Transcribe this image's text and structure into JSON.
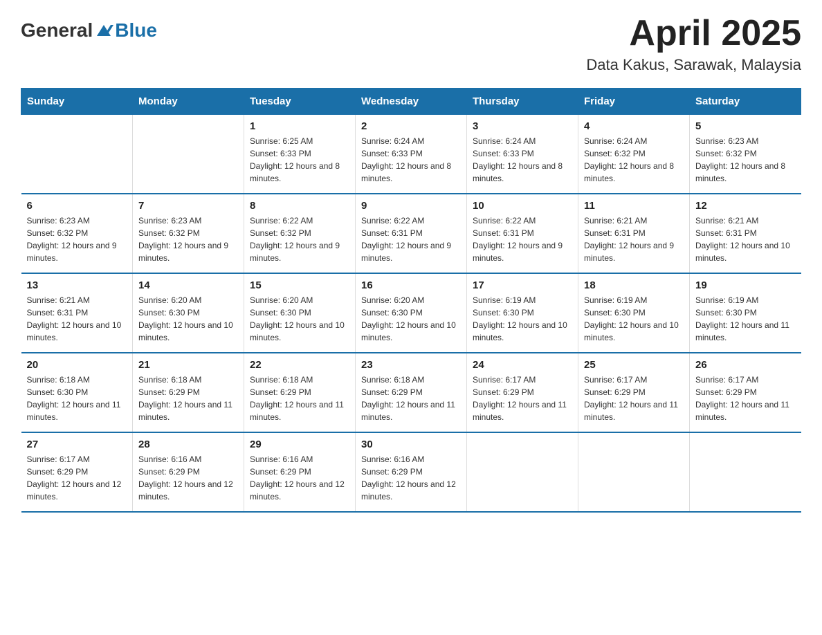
{
  "header": {
    "logo_general": "General",
    "logo_blue": "Blue",
    "month_title": "April 2025",
    "location": "Data Kakus, Sarawak, Malaysia"
  },
  "days_of_week": [
    "Sunday",
    "Monday",
    "Tuesday",
    "Wednesday",
    "Thursday",
    "Friday",
    "Saturday"
  ],
  "weeks": [
    [
      {
        "day": "",
        "sunrise": "",
        "sunset": "",
        "daylight": ""
      },
      {
        "day": "",
        "sunrise": "",
        "sunset": "",
        "daylight": ""
      },
      {
        "day": "1",
        "sunrise": "Sunrise: 6:25 AM",
        "sunset": "Sunset: 6:33 PM",
        "daylight": "Daylight: 12 hours and 8 minutes."
      },
      {
        "day": "2",
        "sunrise": "Sunrise: 6:24 AM",
        "sunset": "Sunset: 6:33 PM",
        "daylight": "Daylight: 12 hours and 8 minutes."
      },
      {
        "day": "3",
        "sunrise": "Sunrise: 6:24 AM",
        "sunset": "Sunset: 6:33 PM",
        "daylight": "Daylight: 12 hours and 8 minutes."
      },
      {
        "day": "4",
        "sunrise": "Sunrise: 6:24 AM",
        "sunset": "Sunset: 6:32 PM",
        "daylight": "Daylight: 12 hours and 8 minutes."
      },
      {
        "day": "5",
        "sunrise": "Sunrise: 6:23 AM",
        "sunset": "Sunset: 6:32 PM",
        "daylight": "Daylight: 12 hours and 8 minutes."
      }
    ],
    [
      {
        "day": "6",
        "sunrise": "Sunrise: 6:23 AM",
        "sunset": "Sunset: 6:32 PM",
        "daylight": "Daylight: 12 hours and 9 minutes."
      },
      {
        "day": "7",
        "sunrise": "Sunrise: 6:23 AM",
        "sunset": "Sunset: 6:32 PM",
        "daylight": "Daylight: 12 hours and 9 minutes."
      },
      {
        "day": "8",
        "sunrise": "Sunrise: 6:22 AM",
        "sunset": "Sunset: 6:32 PM",
        "daylight": "Daylight: 12 hours and 9 minutes."
      },
      {
        "day": "9",
        "sunrise": "Sunrise: 6:22 AM",
        "sunset": "Sunset: 6:31 PM",
        "daylight": "Daylight: 12 hours and 9 minutes."
      },
      {
        "day": "10",
        "sunrise": "Sunrise: 6:22 AM",
        "sunset": "Sunset: 6:31 PM",
        "daylight": "Daylight: 12 hours and 9 minutes."
      },
      {
        "day": "11",
        "sunrise": "Sunrise: 6:21 AM",
        "sunset": "Sunset: 6:31 PM",
        "daylight": "Daylight: 12 hours and 9 minutes."
      },
      {
        "day": "12",
        "sunrise": "Sunrise: 6:21 AM",
        "sunset": "Sunset: 6:31 PM",
        "daylight": "Daylight: 12 hours and 10 minutes."
      }
    ],
    [
      {
        "day": "13",
        "sunrise": "Sunrise: 6:21 AM",
        "sunset": "Sunset: 6:31 PM",
        "daylight": "Daylight: 12 hours and 10 minutes."
      },
      {
        "day": "14",
        "sunrise": "Sunrise: 6:20 AM",
        "sunset": "Sunset: 6:30 PM",
        "daylight": "Daylight: 12 hours and 10 minutes."
      },
      {
        "day": "15",
        "sunrise": "Sunrise: 6:20 AM",
        "sunset": "Sunset: 6:30 PM",
        "daylight": "Daylight: 12 hours and 10 minutes."
      },
      {
        "day": "16",
        "sunrise": "Sunrise: 6:20 AM",
        "sunset": "Sunset: 6:30 PM",
        "daylight": "Daylight: 12 hours and 10 minutes."
      },
      {
        "day": "17",
        "sunrise": "Sunrise: 6:19 AM",
        "sunset": "Sunset: 6:30 PM",
        "daylight": "Daylight: 12 hours and 10 minutes."
      },
      {
        "day": "18",
        "sunrise": "Sunrise: 6:19 AM",
        "sunset": "Sunset: 6:30 PM",
        "daylight": "Daylight: 12 hours and 10 minutes."
      },
      {
        "day": "19",
        "sunrise": "Sunrise: 6:19 AM",
        "sunset": "Sunset: 6:30 PM",
        "daylight": "Daylight: 12 hours and 11 minutes."
      }
    ],
    [
      {
        "day": "20",
        "sunrise": "Sunrise: 6:18 AM",
        "sunset": "Sunset: 6:30 PM",
        "daylight": "Daylight: 12 hours and 11 minutes."
      },
      {
        "day": "21",
        "sunrise": "Sunrise: 6:18 AM",
        "sunset": "Sunset: 6:29 PM",
        "daylight": "Daylight: 12 hours and 11 minutes."
      },
      {
        "day": "22",
        "sunrise": "Sunrise: 6:18 AM",
        "sunset": "Sunset: 6:29 PM",
        "daylight": "Daylight: 12 hours and 11 minutes."
      },
      {
        "day": "23",
        "sunrise": "Sunrise: 6:18 AM",
        "sunset": "Sunset: 6:29 PM",
        "daylight": "Daylight: 12 hours and 11 minutes."
      },
      {
        "day": "24",
        "sunrise": "Sunrise: 6:17 AM",
        "sunset": "Sunset: 6:29 PM",
        "daylight": "Daylight: 12 hours and 11 minutes."
      },
      {
        "day": "25",
        "sunrise": "Sunrise: 6:17 AM",
        "sunset": "Sunset: 6:29 PM",
        "daylight": "Daylight: 12 hours and 11 minutes."
      },
      {
        "day": "26",
        "sunrise": "Sunrise: 6:17 AM",
        "sunset": "Sunset: 6:29 PM",
        "daylight": "Daylight: 12 hours and 11 minutes."
      }
    ],
    [
      {
        "day": "27",
        "sunrise": "Sunrise: 6:17 AM",
        "sunset": "Sunset: 6:29 PM",
        "daylight": "Daylight: 12 hours and 12 minutes."
      },
      {
        "day": "28",
        "sunrise": "Sunrise: 6:16 AM",
        "sunset": "Sunset: 6:29 PM",
        "daylight": "Daylight: 12 hours and 12 minutes."
      },
      {
        "day": "29",
        "sunrise": "Sunrise: 6:16 AM",
        "sunset": "Sunset: 6:29 PM",
        "daylight": "Daylight: 12 hours and 12 minutes."
      },
      {
        "day": "30",
        "sunrise": "Sunrise: 6:16 AM",
        "sunset": "Sunset: 6:29 PM",
        "daylight": "Daylight: 12 hours and 12 minutes."
      },
      {
        "day": "",
        "sunrise": "",
        "sunset": "",
        "daylight": ""
      },
      {
        "day": "",
        "sunrise": "",
        "sunset": "",
        "daylight": ""
      },
      {
        "day": "",
        "sunrise": "",
        "sunset": "",
        "daylight": ""
      }
    ]
  ]
}
